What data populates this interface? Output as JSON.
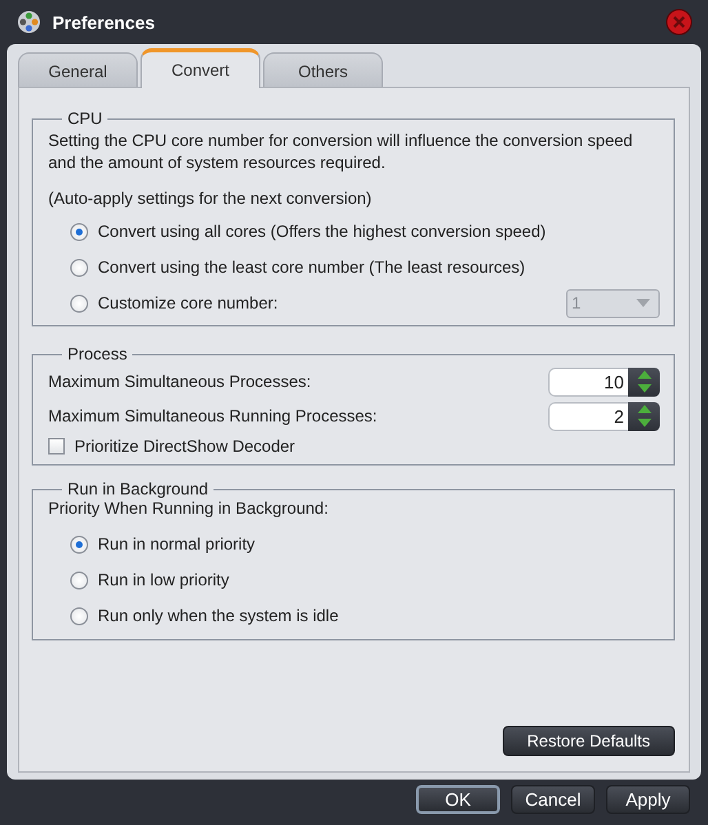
{
  "window": {
    "title": "Preferences"
  },
  "tabs": [
    {
      "label": "General",
      "selected": false
    },
    {
      "label": "Convert",
      "selected": true
    },
    {
      "label": "Others",
      "selected": false
    }
  ],
  "cpu": {
    "title": "CPU",
    "description": "Setting the CPU core number for conversion will influence the conversion speed and the amount of system resources required.",
    "note": "(Auto-apply settings for the next conversion)",
    "options": [
      {
        "label": "Convert using all cores (Offers the highest conversion speed)",
        "selected": true
      },
      {
        "label": "Convert using the least core number (The least resources)",
        "selected": false
      },
      {
        "label": "Customize core number:",
        "selected": false
      }
    ],
    "core_number": {
      "value": "1",
      "disabled": true
    }
  },
  "process": {
    "title": "Process",
    "spinners": [
      {
        "label": "Maximum Simultaneous Processes:",
        "value": "10"
      },
      {
        "label": "Maximum Simultaneous Running Processes:",
        "value": "2"
      }
    ],
    "checkbox": {
      "label": "Prioritize DirectShow Decoder",
      "checked": false
    }
  },
  "background": {
    "title": "Run in Background",
    "label": "Priority When Running in Background:",
    "options": [
      {
        "label": "Run in normal priority",
        "selected": true
      },
      {
        "label": "Run in low priority",
        "selected": false
      },
      {
        "label": "Run only when the system is idle",
        "selected": false
      }
    ]
  },
  "restore_button": "Restore Defaults",
  "buttons": [
    {
      "label": "OK",
      "default": true
    },
    {
      "label": "Cancel",
      "default": false
    },
    {
      "label": "Apply",
      "default": false
    }
  ]
}
